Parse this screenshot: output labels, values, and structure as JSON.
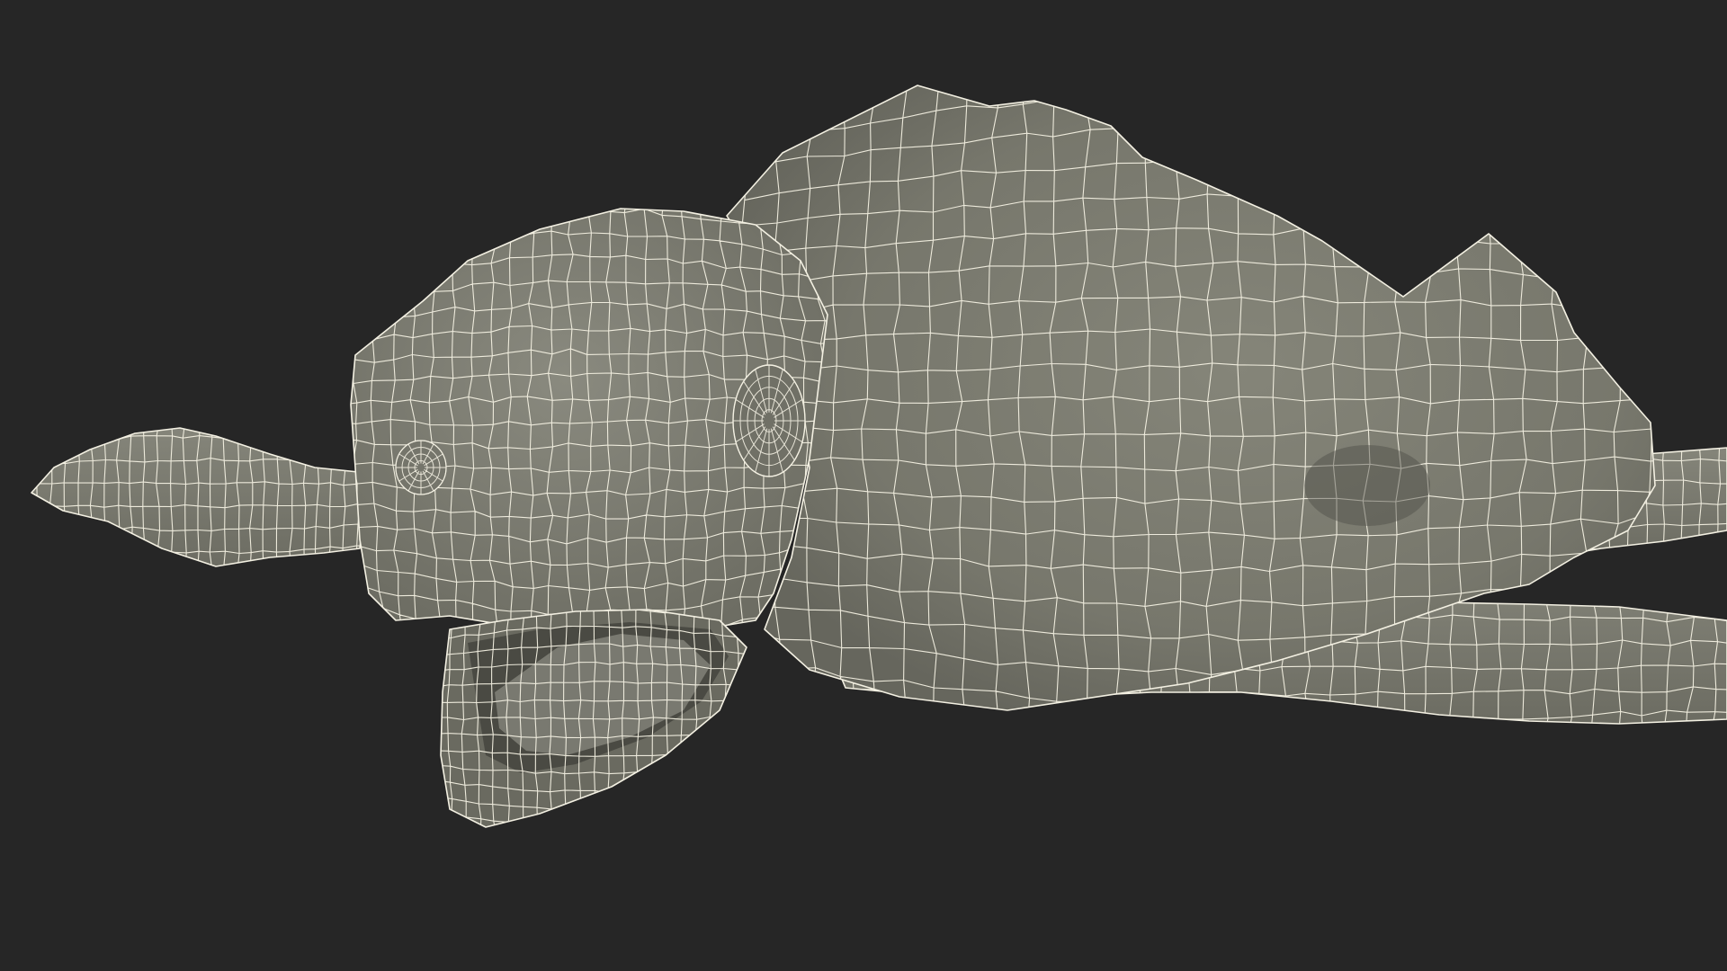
{
  "scene": {
    "subject": "sea-turtle-wireframe",
    "render_mode": "shaded-wireframe"
  },
  "colors": {
    "background": "#262626",
    "surface": "#7d7d72",
    "surface_light": "#8a8a7f",
    "surface_dark": "#5f5f56",
    "wire": "#f3f0e2"
  }
}
